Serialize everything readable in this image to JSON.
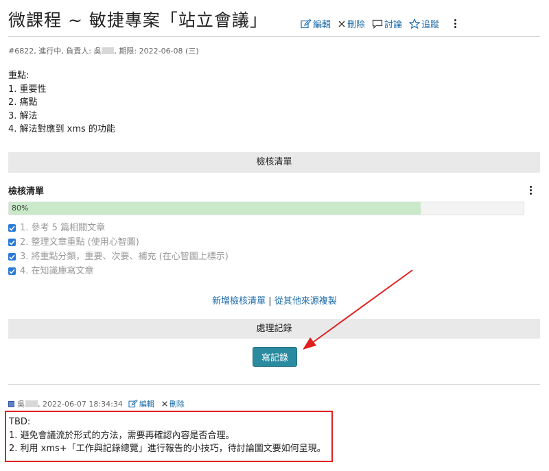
{
  "page": {
    "title": "微課程 ~ 敏捷專案「站立會議」",
    "actions": [
      {
        "label": "編輯",
        "icon": "edit-icon"
      },
      {
        "label": "刪除",
        "icon": "close-icon"
      },
      {
        "label": "討論",
        "icon": "comment-icon"
      },
      {
        "label": "追蹤",
        "icon": "star-icon"
      }
    ],
    "meta_prefix": "#6822, 進行中, 負責人: 吳",
    "meta_suffix": ", 期限: 2022-06-08 (三)"
  },
  "description": {
    "heading": "重點:",
    "items": [
      "1. 重要性",
      "2. 痛點",
      "3. 解法",
      "4. 解法對應到 xms 的功能"
    ]
  },
  "checklist_section": {
    "bar_label": "檢核清單",
    "title": "檢核清單",
    "progress_percent": 80,
    "progress_text": "80%",
    "items": [
      {
        "label": "1. 參考 5 篇相關文章",
        "checked": true
      },
      {
        "label": "2. 整理文章重點 (使用心智圖)",
        "checked": true
      },
      {
        "label": "3. 將重點分類，重要、次要、補充 (在心智圖上標示)",
        "checked": true
      },
      {
        "label": "4. 在知識庫寫文章",
        "checked": true
      }
    ],
    "add_link": "新增檢核清單",
    "separator": "|",
    "copy_link": "從其他來源複製"
  },
  "records_section": {
    "bar_label": "處理記錄",
    "write_button": "寫記錄"
  },
  "log": {
    "author_prefix": "吳",
    "timestamp": ", 2022-06-07 18:34:34",
    "edit_label": "編輯",
    "delete_label": "刪除",
    "lines": [
      "TBD:",
      "1. 避免會議流於形式的方法，需要再確認內容是否合理。",
      "2. 利用 xms+「工作與記錄總覽」進行報告的小技巧，待討論圖文要如何呈現。"
    ]
  },
  "colors": {
    "link": "#1a6aa8",
    "button": "#2a8ba0",
    "annotation": "#e02020",
    "progress_fill": "#c9e9c9"
  }
}
